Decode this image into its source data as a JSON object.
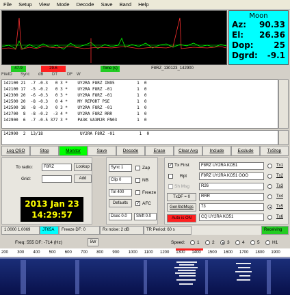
{
  "menu": [
    "File",
    "Setup",
    "View",
    "Mode",
    "Decode",
    "Save",
    "Band",
    "Help"
  ],
  "moon": {
    "title": "Moon",
    "az_label": "Az:",
    "az": "90.33",
    "el_label": "El:",
    "el": "26.36",
    "dop_label": "Dop:",
    "dop": "25",
    "dgrd_label": "Dgrd:",
    "dgrd": "-9.1"
  },
  "strip": {
    "a": "47.9",
    "b": "29.6",
    "c": "Time (s)",
    "file": "F8RZ_130123_142900"
  },
  "decode_header": [
    "FileID",
    "Sync",
    "dB",
    "DT",
    "DF",
    "W"
  ],
  "decode_lines": [
    "142100 21  -7 -0.3   0 3 *    UY2RA F8RZ IN95         1  0",
    "142100 17  -5 -0.2   0 3 *    UY2RA F8RZ -01          1  0",
    "142300 20  -6 -0.3   0 3 *    UY2RA F8RZ -01          1  0",
    "142500 20  -8 -0.3   0 4 *    MY REPORT PSE           1  0",
    "142500 18  -8 -0.3   0 3 *    UY2RA F8RZ -01          1  0",
    "142700  8  -8 -0.2  -3 4 *    UY2RA F8RZ RRR          1  0",
    "142900  6  -7 -0.5 377 3 *    PA3K VA3MJR FN03        1  0"
  ],
  "decode2_lines": [
    "142900  2  13/18               UY2RA F8RZ -01          1  0"
  ],
  "buttons": [
    "Log QSO",
    "Stop",
    "Monitor",
    "Save",
    "Decode",
    "Erase",
    "Clear Avg",
    "Include",
    "Exclude",
    "TxStop"
  ],
  "left": {
    "to_radio_label": "To radio:",
    "to_radio": "F8RZ",
    "lookup": "Lookup",
    "grid_label": "Grid:",
    "grid": "",
    "add": "Add",
    "date": "2013 Jan 23",
    "time": "14:29:57"
  },
  "mid": {
    "sync_label": "Sync",
    "sync": "1",
    "clip_label": "Clip",
    "clip": "0",
    "tol_label": "Tol",
    "tol": "400",
    "zap": "Zap",
    "nb": "NB",
    "freeze": "Freeze",
    "afc": "AFC",
    "defaults": "Defaults",
    "dsec": "Dsec 0.0",
    "shift": "Shift 0.0"
  },
  "right": {
    "txfirst": "Tx First",
    "rpt": "Rpt",
    "sh_msg": "Sh Msg",
    "txdf": "TxDF = 0",
    "genstd": "GenStdMsgs",
    "autoon": "Auto is ON",
    "msgs": [
      "F8RZ UY2RA KO51",
      "F8RZ UY2RA KO51 OOO",
      "R26",
      "RRR",
      "73",
      "CQ UY2RA KO51"
    ],
    "tx": [
      "Tx1",
      "Tx2",
      "Tx3",
      "Tx4",
      "Tx5",
      "Tx6"
    ]
  },
  "statusbar": [
    "1.0000  1.0069",
    "JT65A",
    "Freeze DF: 0",
    "Rx noise: 2 dB",
    "TR Period: 60 s",
    "Receiving"
  ],
  "wf": {
    "freq": "Freq:  555  DF: -714  (Hz)",
    "sv": "5W",
    "speed_label": "Speed:",
    "speeds": [
      "1",
      "2",
      "3",
      "4",
      "5"
    ],
    "h1": "H1"
  },
  "scale": [
    "200",
    "300",
    "400",
    "500",
    "600",
    "700",
    "800",
    "900",
    "1000",
    "1100",
    "1200",
    "1300",
    "1400",
    "1500",
    "1600",
    "1700",
    "1800",
    "1900"
  ],
  "colors": {
    "moon_bg": "#00ffff",
    "clock_bg": "#000000",
    "clock_fg": "#ffff00",
    "monitor": "#00ff00",
    "autoon": "#ff2020",
    "receiving": "#22cc22",
    "jt65": "#00ffff"
  }
}
